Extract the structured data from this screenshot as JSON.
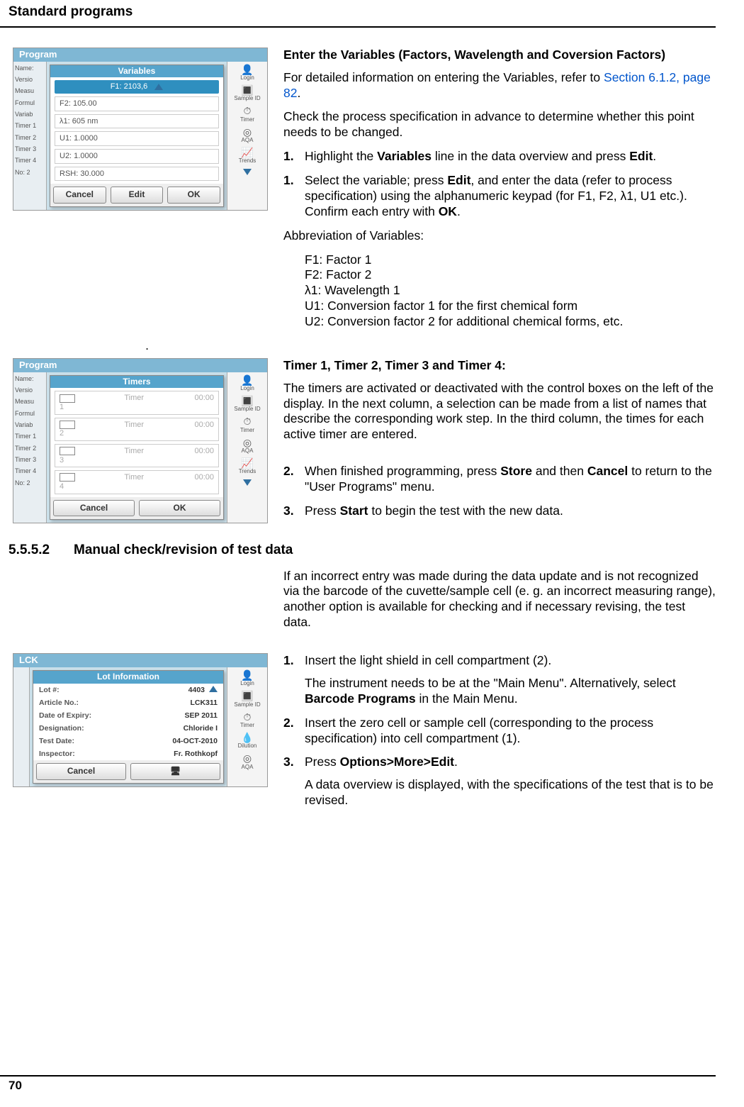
{
  "running_head": "Standard programs",
  "page_number": "70",
  "period_marker": ".",
  "fig1": {
    "program_bar": "Program",
    "side_labels": [
      "Name:",
      "Versio",
      "Measu",
      "Formul",
      "Variab",
      "Timer 1",
      "Timer 2",
      "Timer 3",
      "Timer 4",
      "No: 2"
    ],
    "modal_title": "Variables",
    "first_row": "F1: 2103,6",
    "rows": [
      "F2: 105.00",
      "λ1: 605 nm",
      "U1: 1.0000",
      "U2: 1.0000",
      "RSH: 30.000"
    ],
    "buttons": [
      "Cancel",
      "Edit",
      "OK"
    ],
    "right_icons": [
      {
        "icon": "👤",
        "label": "Login"
      },
      {
        "icon": "🔳",
        "label": "Sample ID"
      },
      {
        "icon": "⏱",
        "label": "Timer"
      },
      {
        "icon": "◎",
        "label": "AQA"
      },
      {
        "icon": "📈",
        "label": "Trends"
      }
    ]
  },
  "fig2": {
    "program_bar": "Program",
    "side_labels": [
      "Name:",
      "Versio",
      "Measu",
      "Formul",
      "Variab",
      "Timer 1",
      "Timer 2",
      "Timer 3",
      "Timer 4",
      "No: 2"
    ],
    "modal_title": "Timers",
    "timer_rows": [
      {
        "n": "1",
        "name": "Timer",
        "time": "00:00"
      },
      {
        "n": "2",
        "name": "Timer",
        "time": "00:00"
      },
      {
        "n": "3",
        "name": "Timer",
        "time": "00:00"
      },
      {
        "n": "4",
        "name": "Timer",
        "time": "00:00"
      }
    ],
    "buttons": [
      "Cancel",
      "OK"
    ],
    "right_icons": [
      {
        "icon": "👤",
        "label": "Login"
      },
      {
        "icon": "🔳",
        "label": "Sample ID"
      },
      {
        "icon": "⏱",
        "label": "Timer"
      },
      {
        "icon": "◎",
        "label": "AQA"
      },
      {
        "icon": "📈",
        "label": "Trends"
      }
    ]
  },
  "fig3": {
    "top_bar": "LCK",
    "modal_title": "Lot Information",
    "rows": [
      {
        "k": "Lot #:",
        "v": "4403"
      },
      {
        "k": "Article No.:",
        "v": "LCK311"
      },
      {
        "k": "Date of Expiry:",
        "v": "SEP 2011"
      },
      {
        "k": "Designation:",
        "v": "Chloride I"
      },
      {
        "k": "Test Date:",
        "v": "04-OCT-2010"
      },
      {
        "k": "Inspector:",
        "v": "Fr. Rothkopf"
      }
    ],
    "buttons": [
      "Cancel",
      ""
    ],
    "right_icons": [
      {
        "icon": "👤",
        "label": "Login"
      },
      {
        "icon": "🔳",
        "label": "Sample ID"
      },
      {
        "icon": "⏱",
        "label": "Timer"
      },
      {
        "icon": "💧",
        "label": "Dilution"
      },
      {
        "icon": "◎",
        "label": "AQA"
      }
    ]
  },
  "section1": {
    "heading": "Enter the Variables (Factors, Wavelength and Coversion Factors)",
    "p1": "For detailed information on entering the Variables, refer to ",
    "link": "Section 6.1.2, page 82",
    "p1_after": ".",
    "p2": "Check the process specification in advance to determine whether this point needs to be changed.",
    "step1_num": "1.",
    "step1_a": "Highlight the ",
    "step1_b": "Variables",
    "step1_c": " line in the data overview and press ",
    "step1_d": "Edit",
    "step1_e": ".",
    "step2_num": "1.",
    "step2_a": "Select the variable; press ",
    "step2_b": "Edit",
    "step2_c": ", and enter the data (refer to process specification) using the alphanumeric keypad (for F1, F2, λ1, U1 etc.). Confirm each entry with ",
    "step2_d": "OK",
    "step2_e": ".",
    "abbrev_head": "Abbreviation of Variables:",
    "abbrev": [
      "F1: Factor 1",
      "F2: Factor 2",
      "λ1: Wavelength 1",
      "U1: Conversion factor 1 for the first chemical form",
      "U2: Conversion factor 2 for additional chemical forms, etc."
    ]
  },
  "section2": {
    "heading": "Timer 1, Timer 2, Timer 3 and Timer 4:",
    "p1": "The timers are activated or deactivated with the control boxes on the left of the display. In the next column, a selection can be made from a list of names that describe the corresponding work step. In the third column, the times for each active timer are entered.",
    "step2_num": "2.",
    "step2_a": "When finished programming, press ",
    "step2_b": "Store",
    "step2_c": " and then ",
    "step2_d": "Cancel",
    "step2_e": " to return to the \"User Programs\" menu.",
    "step3_num": "3.",
    "step3_a": "Press ",
    "step3_b": "Start",
    "step3_c": " to begin the test with the new data."
  },
  "subsection": {
    "num": "5.5.5.2",
    "title": "Manual check/revision of test data",
    "p1": "If an incorrect entry was made during the data update and is not recognized via the barcode of the cuvette/sample cell (e. g. an incorrect measuring range), another option is available for checking and if necessary revising, the test data."
  },
  "section3": {
    "step1_num": "1.",
    "step1_a": "Insert the light shield in cell compartment (2).",
    "step1_b1": "The instrument needs to be at the \"Main Menu\". Alternatively, select ",
    "step1_b2": "Barcode Programs",
    "step1_b3": " in the Main Menu.",
    "step2_num": "2.",
    "step2_a": "Insert the zero cell or sample cell (corresponding to the process specification) into cell compartment (1).",
    "step3_num": "3.",
    "step3_a": "Press ",
    "step3_b": "Options>More>Edit",
    "step3_c": ".",
    "step3_p2": "A data overview is displayed, with the specifications of the test that is to be revised."
  }
}
